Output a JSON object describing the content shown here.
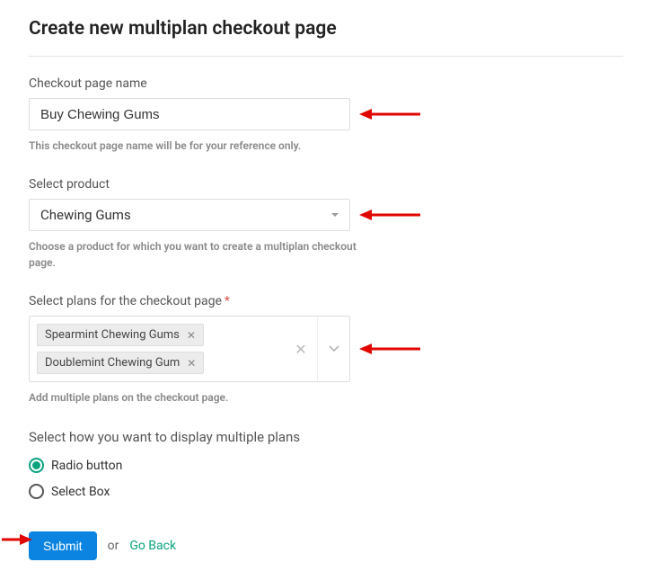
{
  "page": {
    "title": "Create new multiplan checkout page"
  },
  "fields": {
    "checkoutName": {
      "label": "Checkout page name",
      "value": "Buy Chewing Gums",
      "helper": "This checkout page name will be for your reference only."
    },
    "product": {
      "label": "Select product",
      "value": "Chewing Gums",
      "helper": "Choose a product for which you want to create a multiplan checkout page."
    },
    "plans": {
      "label": "Select plans for the checkout page",
      "required": "*",
      "tags": [
        "Spearmint Chewing Gums",
        "Doublemint Chewing Gum"
      ],
      "helper": "Add multiple plans on the checkout page."
    },
    "display": {
      "heading": "Select how you want to display multiple plans",
      "option1": "Radio button",
      "option2": "Select Box"
    }
  },
  "actions": {
    "submit": "Submit",
    "or": "or",
    "goBack": "Go Back"
  }
}
